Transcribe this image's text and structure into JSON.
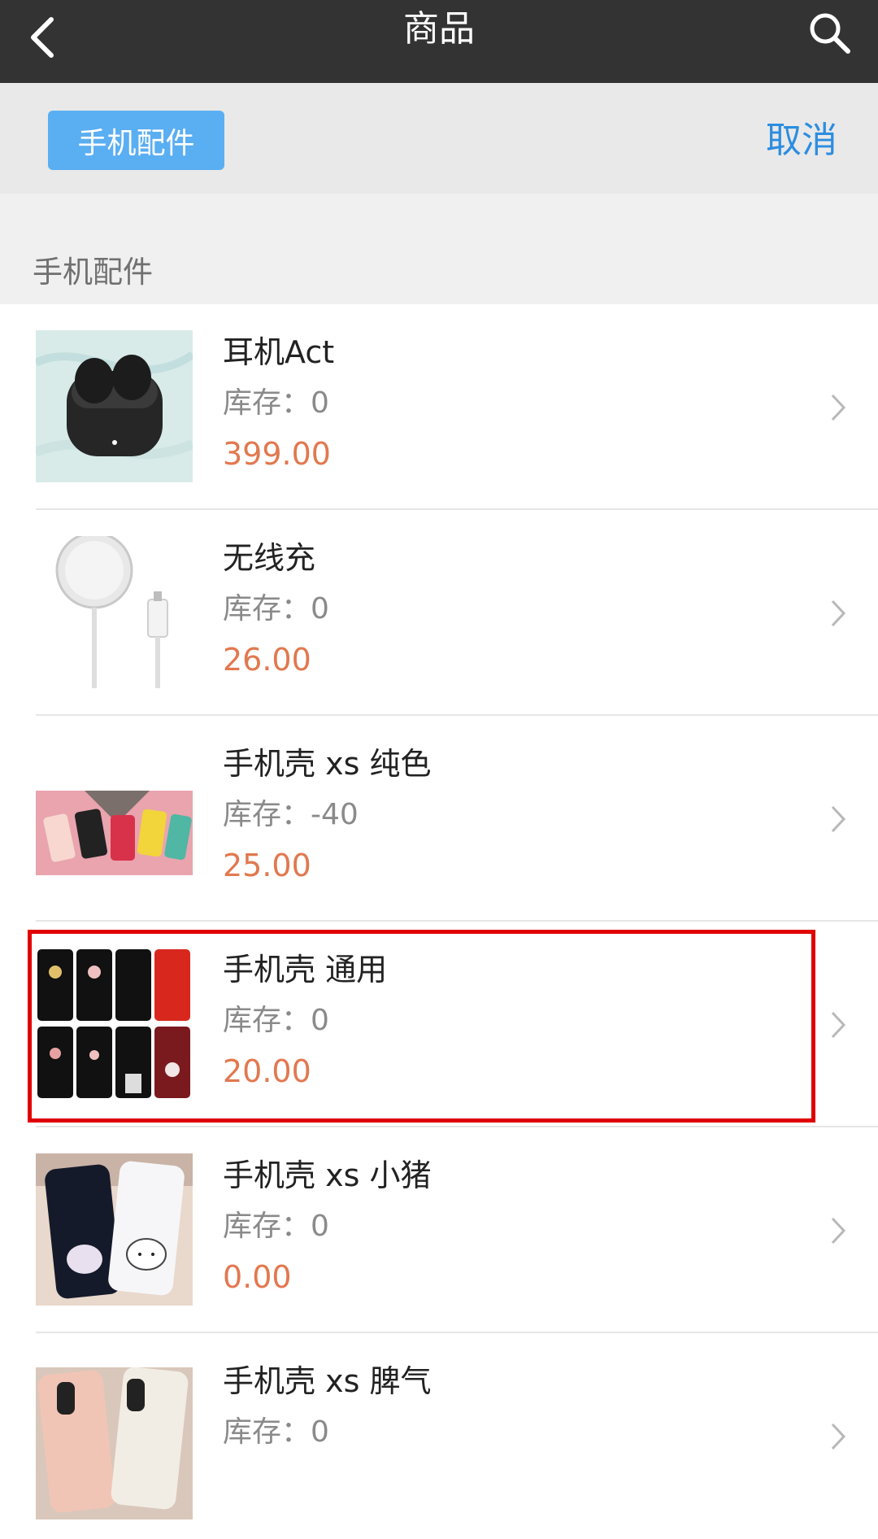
{
  "header": {
    "title": "商品",
    "back_icon": "back-chevron-icon",
    "search_icon": "search-icon"
  },
  "filter": {
    "chip_label": "手机配件",
    "cancel_label": "取消"
  },
  "section": {
    "title": "手机配件"
  },
  "products": [
    {
      "name": "耳机Act",
      "stock": "库存：0",
      "price": "399.00",
      "image": "earbuds-image"
    },
    {
      "name": "无线充",
      "stock": "库存：0",
      "price": "26.00",
      "image": "wireless-charger-image"
    },
    {
      "name": "手机壳 xs 纯色",
      "stock": "库存：-40",
      "price": "25.00",
      "image": "solid-color-cases-image"
    },
    {
      "name": "手机壳 通用",
      "stock": "库存：0",
      "price": "20.00",
      "image": "universal-cases-image"
    },
    {
      "name": "手机壳 xs 小猪",
      "stock": "库存：0",
      "price": "0.00",
      "image": "piglet-cases-image"
    },
    {
      "name": "手机壳 xs 脾气",
      "stock": "库存：0",
      "price": "",
      "image": "temper-cases-image"
    }
  ],
  "colors": {
    "topbar": "#333333",
    "chip": "#5aaef2",
    "cancel": "#2c8de0",
    "price": "#e2784f",
    "highlight": "#e00000"
  }
}
